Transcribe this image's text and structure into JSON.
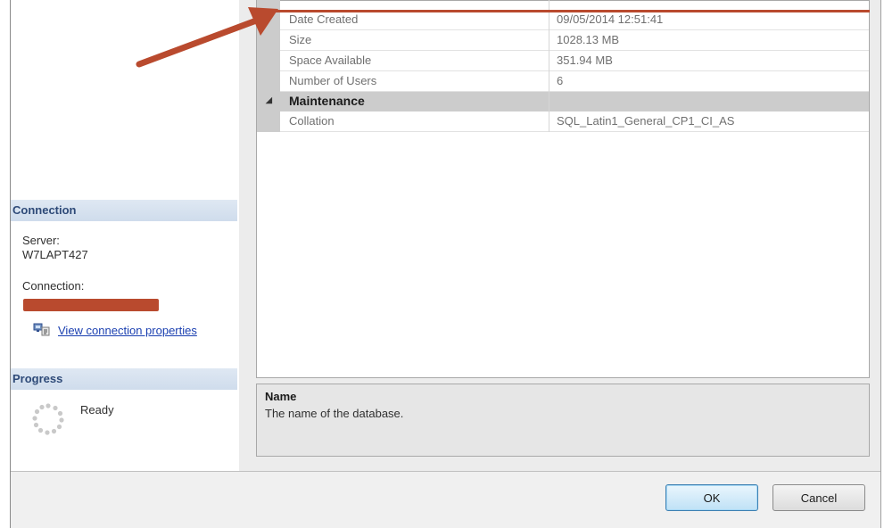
{
  "connection": {
    "header": "Connection",
    "server_label": "Server:",
    "server_value": "W7LAPT427",
    "connection_label": "Connection:",
    "link_label": "View connection properties"
  },
  "progress": {
    "header": "Progress",
    "status": "Ready"
  },
  "properties": {
    "rows": [
      {
        "name": "Date Created",
        "value": "09/05/2014 12:51:41"
      },
      {
        "name": "Size",
        "value": "1028.13 MB"
      },
      {
        "name": "Space Available",
        "value": "351.94 MB"
      },
      {
        "name": "Number of Users",
        "value": "6"
      }
    ],
    "category": {
      "toggle": "◢",
      "label": "Maintenance"
    },
    "category_rows": [
      {
        "name": "Collation",
        "value": "SQL_Latin1_General_CP1_CI_AS"
      }
    ]
  },
  "description": {
    "title": "Name",
    "text": "The name of the database."
  },
  "buttons": {
    "ok": "OK",
    "cancel": "Cancel"
  },
  "colors": {
    "annotation_red": "#b94a2e",
    "header_blue": "#2e4a78",
    "link_blue": "#1a3fb0"
  },
  "icons": {
    "connection": "connection-properties-icon",
    "spinner": "progress-spinner-icon"
  }
}
